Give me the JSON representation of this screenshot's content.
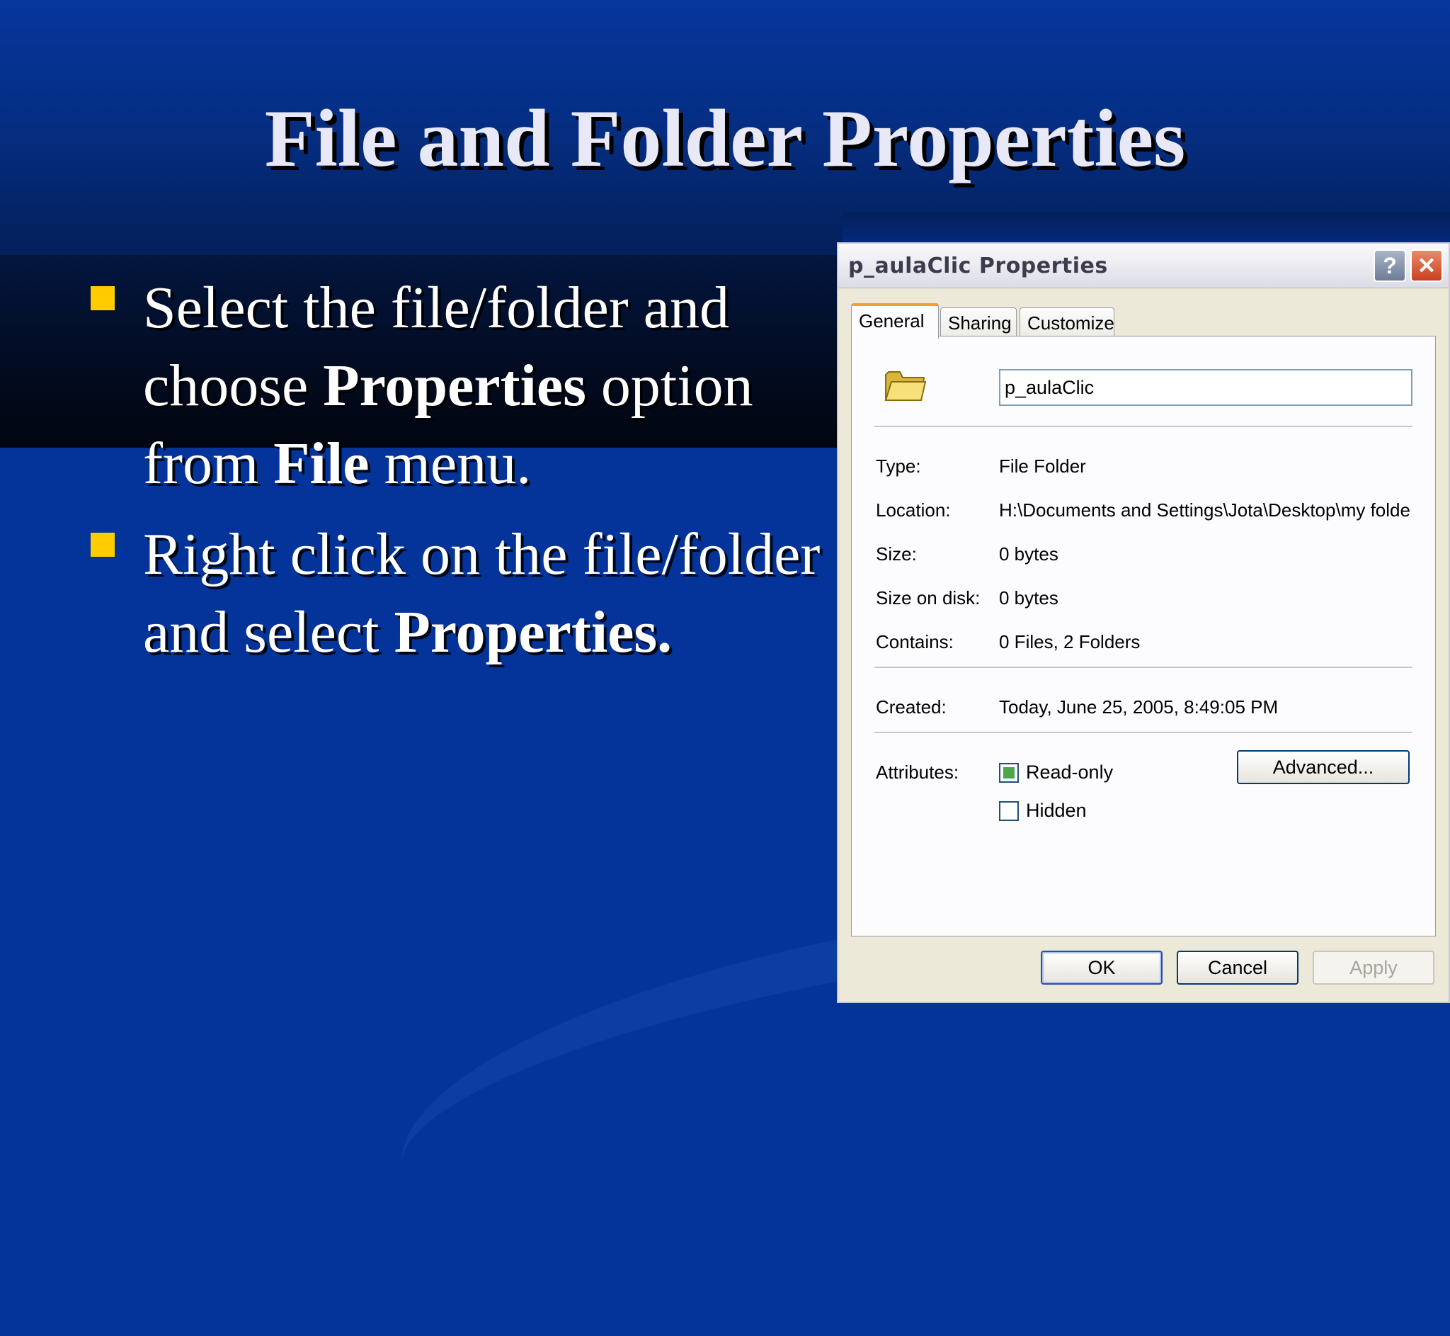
{
  "slide": {
    "title": "File and Folder Properties",
    "bullets": [
      {
        "parts": [
          {
            "text": "Select the file/folder and choose ",
            "bold": false
          },
          {
            "text": "Properties",
            "bold": true
          },
          {
            "text": " option from ",
            "bold": false
          },
          {
            "text": "File",
            "bold": true
          },
          {
            "text": " menu.",
            "bold": false
          }
        ]
      },
      {
        "parts": [
          {
            "text": "Right click on the file/folder and select ",
            "bold": false
          },
          {
            "text": "Properties.",
            "bold": true
          }
        ]
      }
    ],
    "bullet_color": "#ffcc00"
  },
  "dialog": {
    "title": "p_aulaClic Properties",
    "help_symbol": "?",
    "close_symbol": "✕",
    "tabs": [
      "General",
      "Sharing",
      "Customize"
    ],
    "active_tab": "General",
    "name_value": "p_aulaClic",
    "properties": {
      "type_label": "Type:",
      "type_value": "File Folder",
      "location_label": "Location:",
      "location_value": "H:\\Documents and Settings\\Jota\\Desktop\\my folde",
      "size_label": "Size:",
      "size_value": "0 bytes",
      "size_on_disk_label": "Size on disk:",
      "size_on_disk_value": "0 bytes",
      "contains_label": "Contains:",
      "contains_value": "0 Files, 2 Folders",
      "created_label": "Created:",
      "created_value": "Today, June 25, 2005, 8:49:05 PM",
      "attributes_label": "Attributes:"
    },
    "attributes": {
      "readonly_label": "Read-only",
      "readonly_state": "mixed",
      "hidden_label": "Hidden",
      "hidden_state": "unchecked",
      "advanced_label": "Advanced..."
    },
    "buttons": {
      "ok": "OK",
      "cancel": "Cancel",
      "apply": "Apply"
    }
  }
}
